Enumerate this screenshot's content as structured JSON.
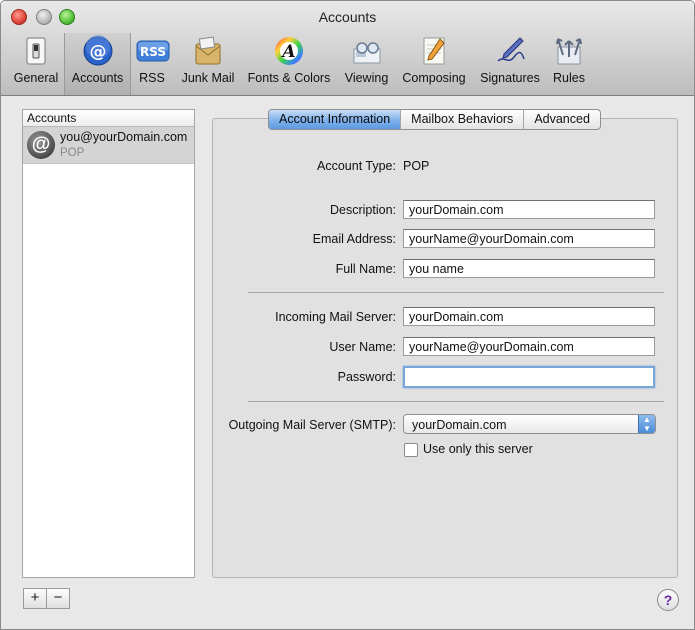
{
  "window": {
    "title": "Accounts"
  },
  "toolbar": {
    "items": [
      {
        "label": "General",
        "icon": "light-switch-icon"
      },
      {
        "label": "Accounts",
        "icon": "at-sign-icon",
        "selected": true
      },
      {
        "label": "RSS",
        "icon": "rss-icon"
      },
      {
        "label": "Junk Mail",
        "icon": "junk-mail-icon"
      },
      {
        "label": "Fonts & Colors",
        "icon": "fonts-colors-icon"
      },
      {
        "label": "Viewing",
        "icon": "glasses-icon"
      },
      {
        "label": "Composing",
        "icon": "notepad-pencil-icon"
      },
      {
        "label": "Signatures",
        "icon": "pen-signature-icon"
      },
      {
        "label": "Rules",
        "icon": "rules-arrows-icon"
      }
    ],
    "rss_badge": "RSS"
  },
  "accounts": {
    "header": "Accounts",
    "list": [
      {
        "name": "you@yourDomain.com",
        "type": "POP",
        "icon_glyph": "@"
      }
    ],
    "add_label": "+",
    "remove_label": "−"
  },
  "tabs": [
    {
      "label": "Account Information",
      "active": true
    },
    {
      "label": "Mailbox Behaviors"
    },
    {
      "label": "Advanced"
    }
  ],
  "form": {
    "account_type_label": "Account Type:",
    "account_type_value": "POP",
    "description_label": "Description:",
    "description_value": "yourDomain.com",
    "email_label": "Email Address:",
    "email_value": "yourName@yourDomain.com",
    "fullname_label": "Full Name:",
    "fullname_value": "you name",
    "incoming_label": "Incoming Mail Server:",
    "incoming_value": "yourDomain.com",
    "username_label": "User Name:",
    "username_value": "yourName@yourDomain.com",
    "password_label": "Password:",
    "password_value": "",
    "smtp_label": "Outgoing Mail Server (SMTP):",
    "smtp_value": "yourDomain.com",
    "use_only_label": "Use only this server",
    "use_only_checked": false
  },
  "help": {
    "label": "?"
  },
  "colors": {
    "tab_active": "#5d9be2",
    "focus_ring": "#79a6da",
    "close": "#e0443a",
    "maximize": "#55c23a"
  }
}
